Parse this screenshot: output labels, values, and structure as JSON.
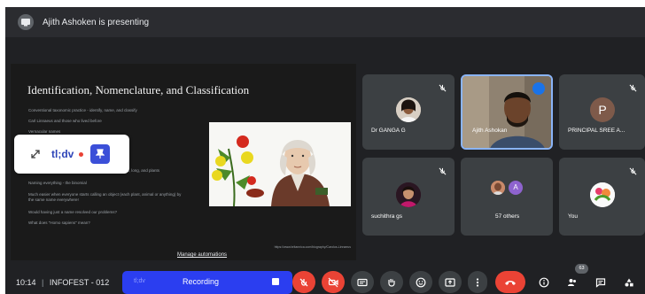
{
  "header": {
    "presenting_text": "Ajith Ashoken is presenting"
  },
  "slide": {
    "title": "Identification, Nomenclature, and Classification",
    "bullets": [
      "Conventional taxonomic practice - identify, name, and classify",
      "Carl Linnaeus and those who lived before",
      "Vernacular names",
      "",
      "",
      "",
      "Naming everything - the binomial",
      "Much easier when everyone starts calling an object (each plant, animal or anything) by the same name everywhere!",
      "Would having just a name resolved our problems?",
      "What does \"Homo sapiens\" mean?"
    ],
    "partial_bullet": "ages, long, and plants",
    "url_text": "https://www.britannica.com/biography/Carolus-Linnaeus"
  },
  "tldv_overlay": {
    "logo": "tl;dv"
  },
  "manage_link": "Manage automations",
  "participants": [
    {
      "name": "Dr GANGA G",
      "muted": true
    },
    {
      "name": "Ajith Ashokan",
      "muted": false
    },
    {
      "name": "PRINCIPAL SREE A...",
      "muted": true,
      "initial": "P"
    },
    {
      "name": "suchithra gs",
      "muted": true
    },
    {
      "name": "57 others",
      "muted": false,
      "mini_initial": "A"
    },
    {
      "name": "You",
      "muted": true
    }
  ],
  "toolbar": {
    "time": "10:14",
    "separator": "|",
    "meeting_name": "INFOFEST - 012",
    "recording_brand": "tl;dv",
    "recording_label": "Recording",
    "people_count": "63"
  },
  "colors": {
    "accent": "#2b3ef0",
    "end_call": "#ea4335",
    "active_speaker": "#8ab4f8"
  }
}
